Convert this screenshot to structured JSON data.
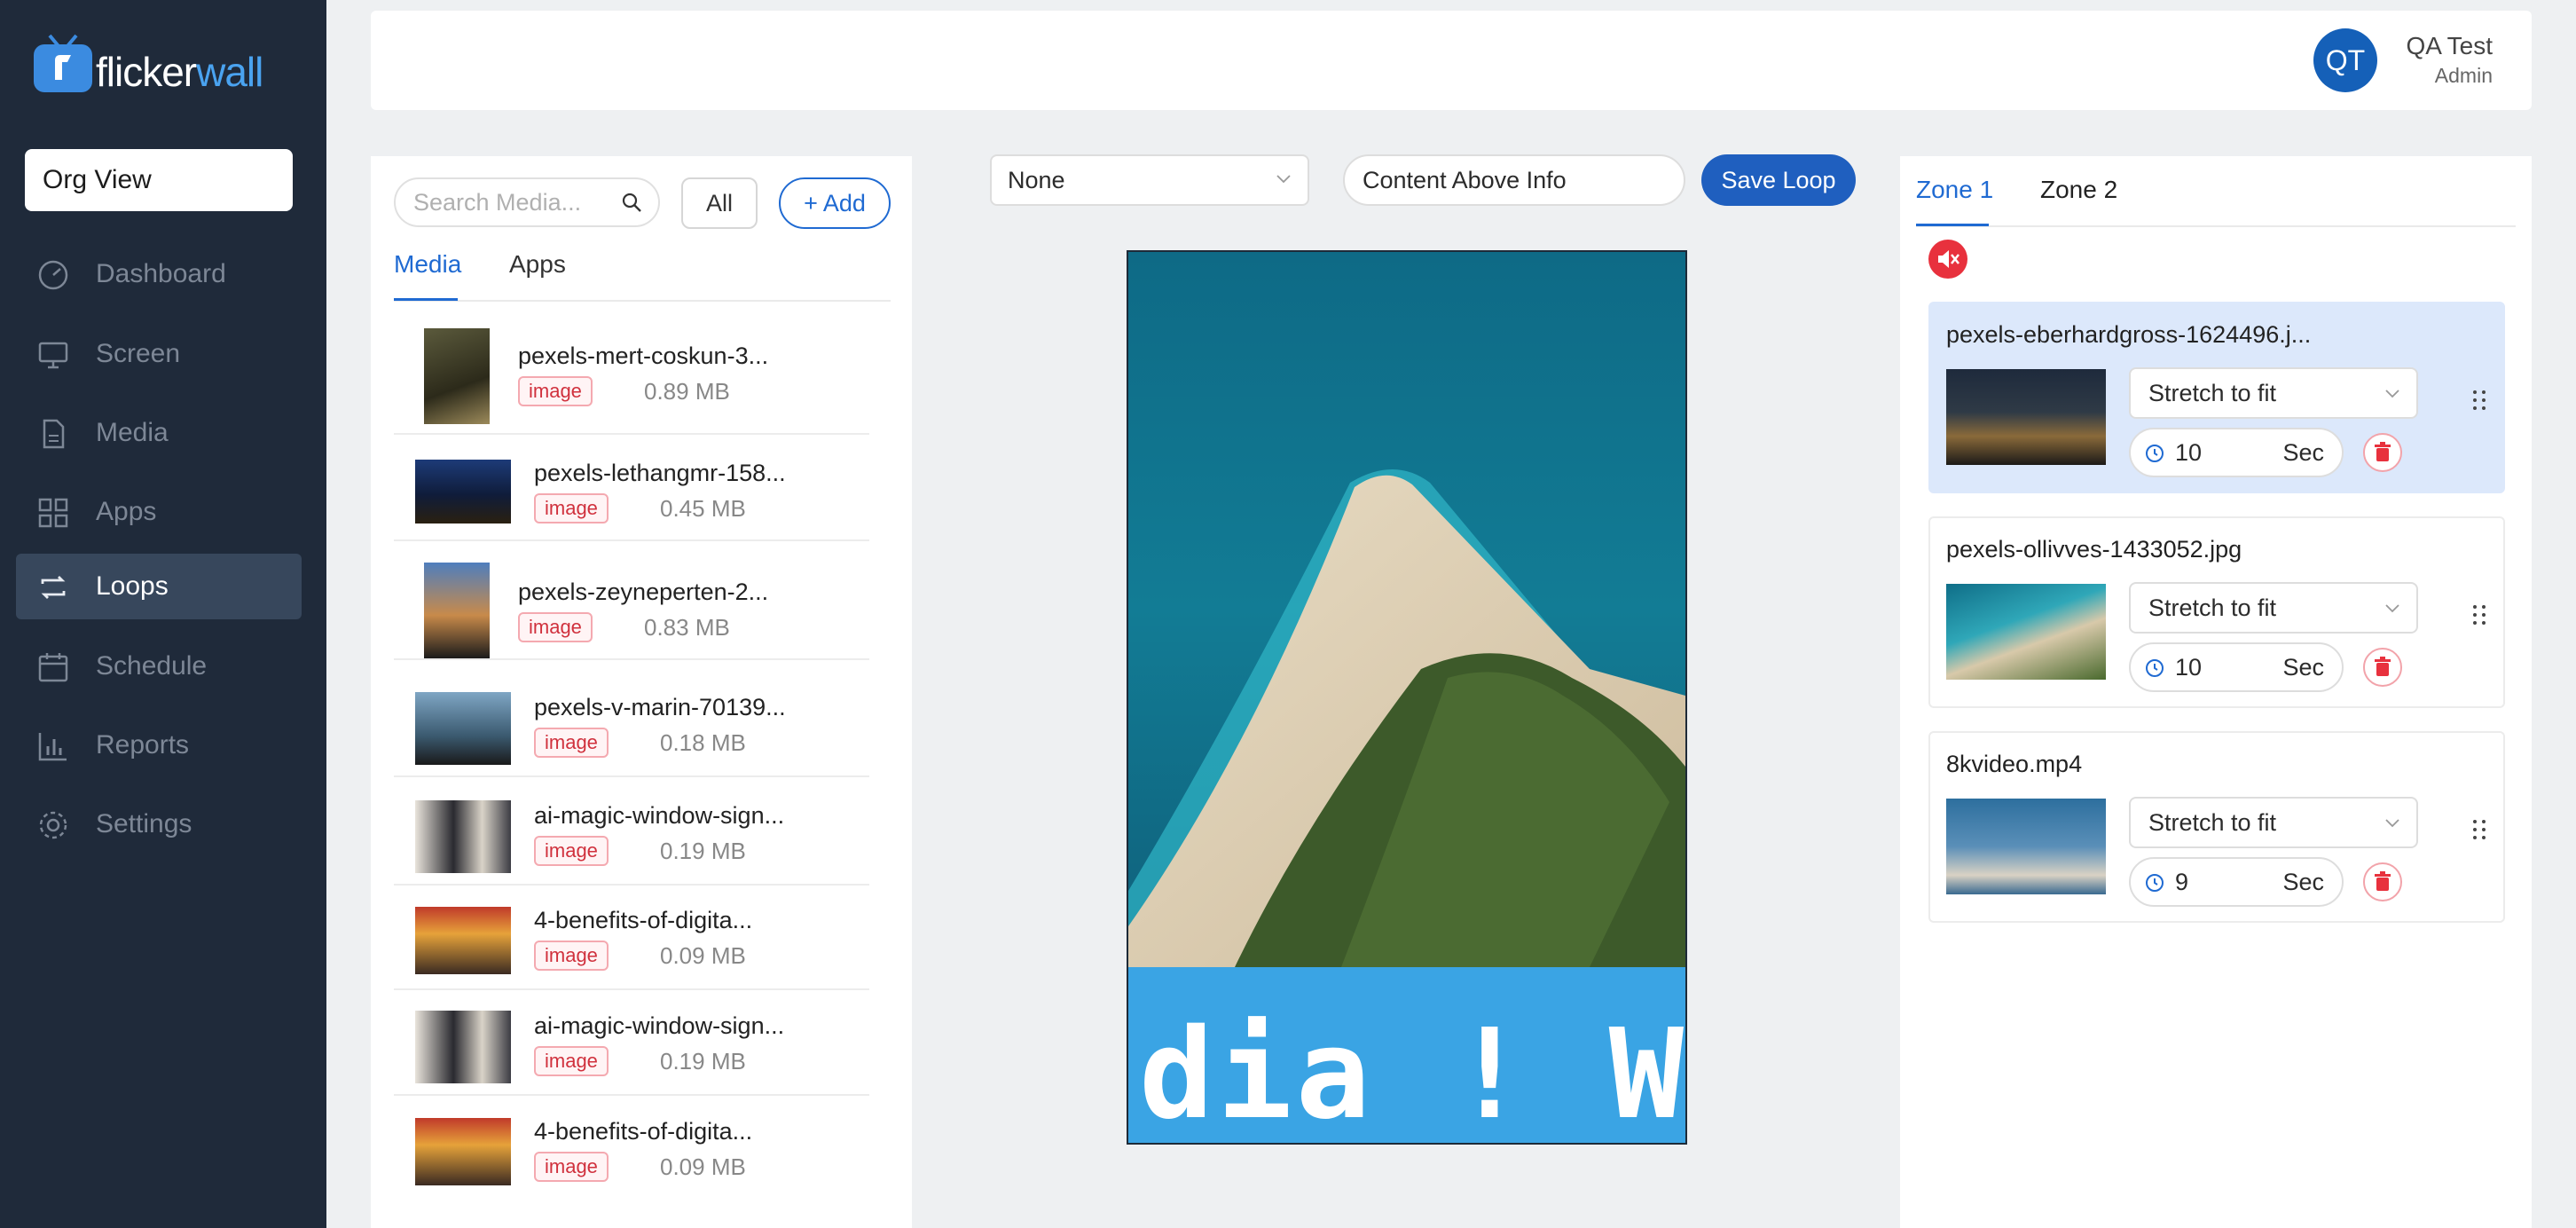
{
  "brand": {
    "name_part1": "flicker",
    "name_part2": "wall"
  },
  "sidebar": {
    "org_view": "Org View",
    "items": [
      {
        "label": "Dashboard",
        "icon": "dashboard-icon"
      },
      {
        "label": "Screen",
        "icon": "monitor-icon"
      },
      {
        "label": "Media",
        "icon": "file-icon"
      },
      {
        "label": "Apps",
        "icon": "grid-icon"
      },
      {
        "label": "Loops",
        "icon": "loop-icon",
        "active": true
      },
      {
        "label": "Schedule",
        "icon": "calendar-icon"
      },
      {
        "label": "Reports",
        "icon": "bar-chart-icon"
      },
      {
        "label": "Settings",
        "icon": "gear-icon"
      }
    ]
  },
  "header": {
    "avatar_initials": "QT",
    "user_name": "QA Test",
    "user_role": "Admin"
  },
  "media_panel": {
    "search_placeholder": "Search Media...",
    "filter_all": "All",
    "add_label": "+ Add",
    "tabs": [
      {
        "label": "Media",
        "active": true
      },
      {
        "label": "Apps"
      }
    ],
    "items": [
      {
        "name": "pexels-mert-coskun-3...",
        "type": "image",
        "size": "0.89 MB"
      },
      {
        "name": "pexels-lethangmr-158...",
        "type": "image",
        "size": "0.45 MB"
      },
      {
        "name": "pexels-zeyneperten-2...",
        "type": "image",
        "size": "0.83 MB"
      },
      {
        "name": "pexels-v-marin-70139...",
        "type": "image",
        "size": "0.18 MB"
      },
      {
        "name": "ai-magic-window-sign...",
        "type": "image",
        "size": "0.19 MB"
      },
      {
        "name": "4-benefits-of-digita...",
        "type": "image",
        "size": "0.09 MB"
      },
      {
        "name": "ai-magic-window-sign...",
        "type": "image",
        "size": "0.19 MB"
      },
      {
        "name": "4-benefits-of-digita...",
        "type": "image",
        "size": "0.09 MB"
      }
    ]
  },
  "editor": {
    "layout_select": "None",
    "layout_name": "Content Above Info",
    "save_label": "Save Loop",
    "ticker_text": "dia ! We"
  },
  "zones": {
    "tabs": [
      {
        "label": "Zone 1",
        "active": true
      },
      {
        "label": "Zone 2"
      }
    ],
    "items": [
      {
        "name": "pexels-eberhardgross-1624496.j...",
        "fit": "Stretch to fit",
        "duration": "10",
        "unit": "Sec",
        "selected": true
      },
      {
        "name": "pexels-ollivves-1433052.jpg",
        "fit": "Stretch to fit",
        "duration": "10",
        "unit": "Sec"
      },
      {
        "name": "8kvideo.mp4",
        "fit": "Stretch to fit",
        "duration": "9",
        "unit": "Sec"
      }
    ]
  },
  "colors": {
    "accent": "#1f6ad2",
    "sidebar": "#1f2a3a",
    "danger": "#e8313d",
    "ticker": "#3aa4e4"
  }
}
